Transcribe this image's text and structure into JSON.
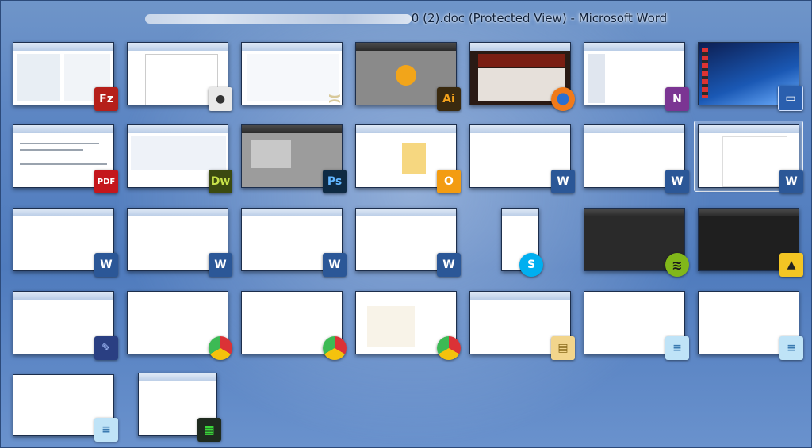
{
  "window_title": "0 (2).doc (Protected View) - Microsoft Word",
  "icons": {
    "filezilla": "Fz",
    "acrobat": "PDF",
    "dreamweaver": "Dw",
    "photoshop": "Ps",
    "illustrator": "Ai",
    "outlook": "O",
    "onenote": "N",
    "word": "W",
    "skype": "S",
    "chrome": "",
    "notepad": "",
    "folder": ""
  }
}
